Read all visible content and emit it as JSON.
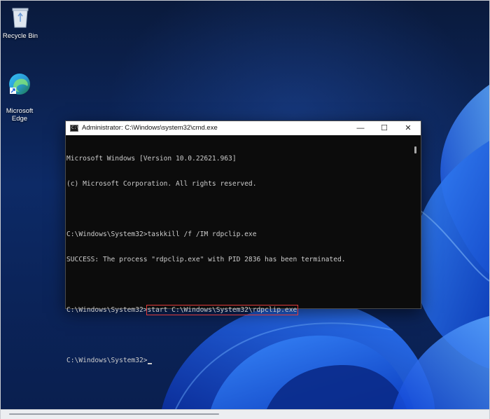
{
  "desktop": {
    "icons": [
      {
        "label": "Recycle Bin",
        "icon": "recycle-bin-icon"
      },
      {
        "label": "Microsoft\nEdge",
        "icon": "edge-icon"
      }
    ]
  },
  "window": {
    "title": "Administrator: C:\\Windows\\system32\\cmd.exe",
    "app_icon_text": "C:\\",
    "controls": {
      "minimize": "—",
      "maximize": "☐",
      "close": "✕"
    }
  },
  "console": {
    "lines": [
      "Microsoft Windows [Version 10.0.22621.963]",
      "(c) Microsoft Corporation. All rights reserved.",
      "",
      "C:\\Windows\\System32>taskkill /f /IM rdpclip.exe",
      "SUCCESS: The process \"rdpclip.exe\" with PID 2836 has been terminated.",
      "",
      "C:\\Windows\\System32>",
      "",
      "C:\\Windows\\System32>"
    ],
    "highlighted_command": "start C:\\Windows\\System32\\rdpclip.exe"
  },
  "colors": {
    "console_bg": "#0c0c0c",
    "console_text": "#cccccc",
    "highlight_box": "#e23b3b",
    "accent_blue": "#1a5fd8"
  }
}
